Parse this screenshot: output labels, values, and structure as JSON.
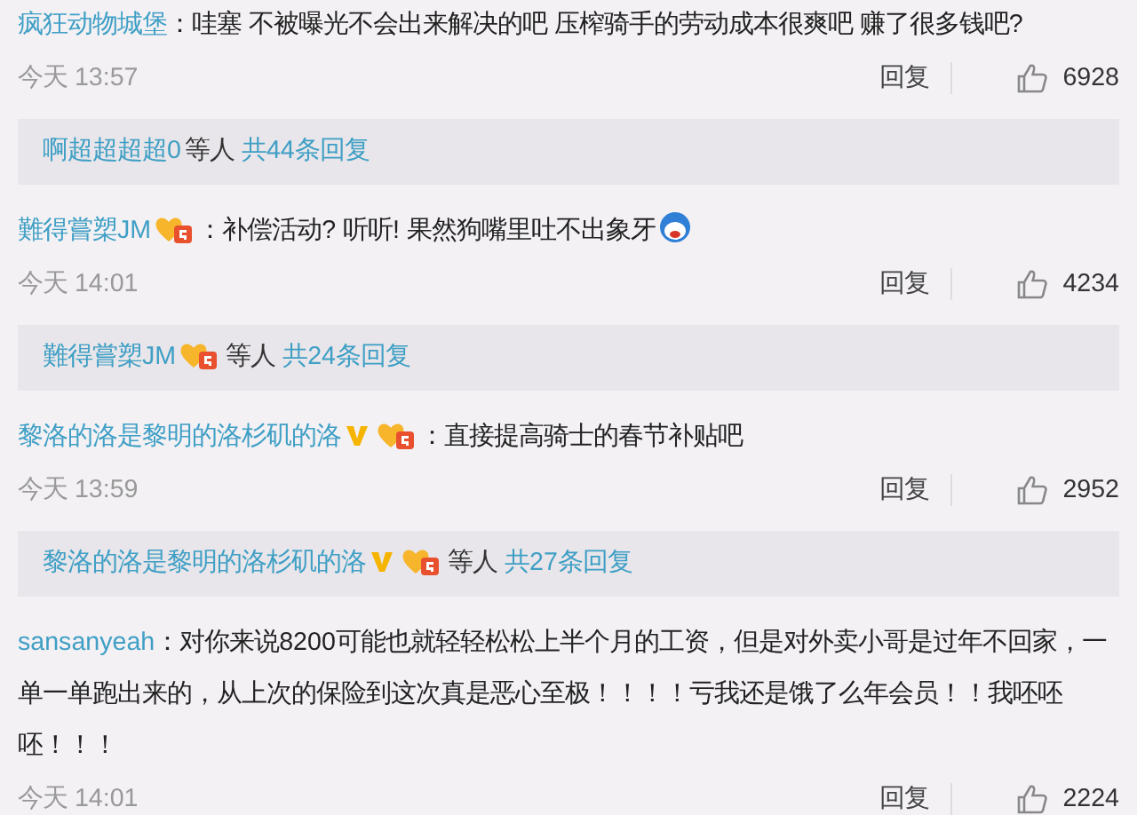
{
  "comments": [
    {
      "name": "疯狂动物城堡",
      "verified": false,
      "level_badge": false,
      "text": "：哇塞 不被曝光不会出来解决的吧 压榨骑手的劳动成本很爽吧 赚了很多钱吧?",
      "emoji": false,
      "time": "今天 13:57",
      "reply": "回复",
      "likes": "6928",
      "summary": {
        "name": "啊超超超超0",
        "verified": false,
        "level_badge": false,
        "others": "等人",
        "total": "共44条回复"
      }
    },
    {
      "name": "難得嘗槊JM",
      "verified": false,
      "level_badge": true,
      "text": "：补偿活动? 听听! 果然狗嘴里吐不出象牙",
      "emoji": true,
      "time": "今天 14:01",
      "reply": "回复",
      "likes": "4234",
      "summary": {
        "name": "難得嘗槊JM",
        "verified": false,
        "level_badge": true,
        "others": "等人",
        "total": "共24条回复"
      }
    },
    {
      "name": "黎洛的洛是黎明的洛杉矶的洛",
      "verified": true,
      "level_badge": true,
      "text": "：直接提高骑士的春节补贴吧",
      "emoji": false,
      "time": "今天 13:59",
      "reply": "回复",
      "likes": "2952",
      "summary": {
        "name": "黎洛的洛是黎明的洛杉矶的洛",
        "verified": true,
        "level_badge": true,
        "others": "等人",
        "total": "共27条回复"
      }
    },
    {
      "name": "sansanyeah",
      "verified": false,
      "level_badge": false,
      "text": "：对你来说8200可能也就轻轻松松上半个月的工资，但是对外卖小哥是过年不回家，一单一单跑出来的，从上次的保险到这次真是恶心至极！！！！亏我还是饿了么年会员！！我呸呸呸！！！",
      "emoji": false,
      "time": "今天 14:01",
      "reply": "回复",
      "likes": "2224"
    }
  ]
}
